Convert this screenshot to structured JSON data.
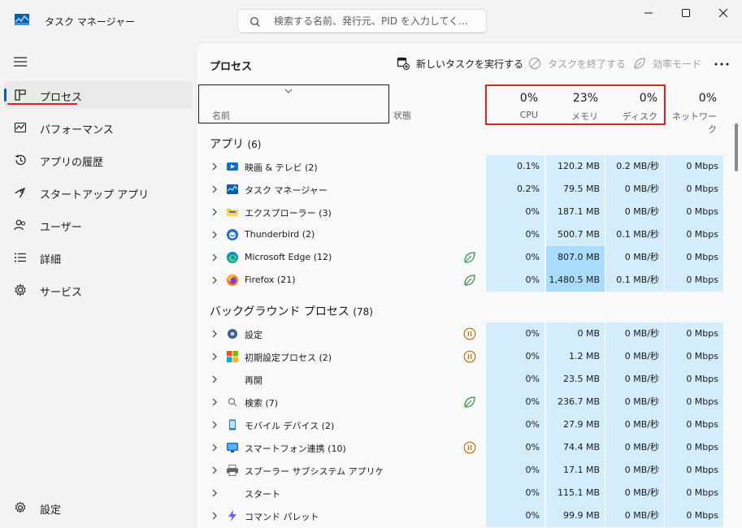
{
  "window": {
    "title": "タスク マネージャー",
    "search_placeholder": "検索する名前、発行元、PID を入力してく..."
  },
  "sidebar": {
    "items": [
      {
        "name": "processes",
        "label": "プロセス",
        "icon": "processes-icon",
        "active": true
      },
      {
        "name": "performance",
        "label": "パフォーマンス",
        "icon": "performance-icon"
      },
      {
        "name": "app-history",
        "label": "アプリの履歴",
        "icon": "history-icon"
      },
      {
        "name": "startup-apps",
        "label": "スタートアップ アプリ",
        "icon": "startup-icon"
      },
      {
        "name": "users",
        "label": "ユーザー",
        "icon": "users-icon"
      },
      {
        "name": "details",
        "label": "詳細",
        "icon": "details-icon"
      },
      {
        "name": "services",
        "label": "サービス",
        "icon": "services-icon"
      }
    ],
    "settings_label": "設定"
  },
  "toolbar": {
    "page_title": "プロセス",
    "new_task_label": "新しいタスクを実行する",
    "end_task_label": "タスクを終了する",
    "efficiency_label": "効率モード"
  },
  "columns": {
    "name": "名前",
    "status": "状態",
    "cpu": {
      "pct": "0%",
      "label": "CPU"
    },
    "memory": {
      "pct": "23%",
      "label": "メモリ"
    },
    "disk": {
      "pct": "0%",
      "label": "ディスク"
    },
    "network": {
      "pct": "0%",
      "label": "ネットワーク"
    }
  },
  "sections": {
    "apps": {
      "title": "アプリ",
      "count": "(6)"
    },
    "background": {
      "title": "バックグラウンド プロセス",
      "count": "(78)"
    }
  },
  "apps": [
    {
      "name": "映画 & テレビ",
      "count": "(2)",
      "icon": "movies-tv-icon",
      "status": "",
      "cpu": "0.1%",
      "mem": "120.2 MB",
      "disk": "0.2 MB/秒",
      "net": "0 Mbps"
    },
    {
      "name": "タスク マネージャー",
      "count": "",
      "icon": "task-manager-icon",
      "status": "",
      "cpu": "0.2%",
      "mem": "79.5 MB",
      "disk": "0 MB/秒",
      "net": "0 Mbps"
    },
    {
      "name": "エクスプローラー",
      "count": "(3)",
      "icon": "folder-icon",
      "status": "",
      "cpu": "0%",
      "mem": "187.1 MB",
      "disk": "0 MB/秒",
      "net": "0 Mbps"
    },
    {
      "name": "Thunderbird",
      "count": "(2)",
      "icon": "thunderbird-icon",
      "status": "",
      "cpu": "0%",
      "mem": "500.7 MB",
      "disk": "0.1 MB/秒",
      "net": "0 Mbps"
    },
    {
      "name": "Microsoft Edge",
      "count": "(12)",
      "icon": "edge-icon",
      "status": "efficiency-leaf-icon",
      "cpu": "0%",
      "mem": "807.0 MB",
      "disk": "0 MB/秒",
      "net": "0 Mbps",
      "hot": true
    },
    {
      "name": "Firefox",
      "count": "(21)",
      "icon": "firefox-icon",
      "status": "efficiency-leaf-icon",
      "cpu": "0%",
      "mem": "1,480.5 MB",
      "disk": "0.1 MB/秒",
      "net": "0 Mbps",
      "hot": true
    }
  ],
  "background": [
    {
      "name": "設定",
      "count": "",
      "icon": "settings-gear-icon",
      "status": "paused-icon",
      "cpu": "0%",
      "mem": "0 MB",
      "disk": "0 MB/秒",
      "net": "0 Mbps"
    },
    {
      "name": "初期設定プロセス",
      "count": "(2)",
      "icon": "windows-logo-icon",
      "status": "paused-icon",
      "cpu": "0%",
      "mem": "1.2 MB",
      "disk": "0 MB/秒",
      "net": "0 Mbps"
    },
    {
      "name": "再開",
      "count": "",
      "icon": "",
      "status": "",
      "cpu": "0%",
      "mem": "23.5 MB",
      "disk": "0 MB/秒",
      "net": "0 Mbps"
    },
    {
      "name": "検索",
      "count": "(7)",
      "icon": "search-process-icon",
      "status": "efficiency-leaf-icon",
      "cpu": "0%",
      "mem": "236.7 MB",
      "disk": "0 MB/秒",
      "net": "0 Mbps"
    },
    {
      "name": "モバイル デバイス",
      "count": "(2)",
      "icon": "mobile-devices-icon",
      "status": "",
      "cpu": "0%",
      "mem": "27.9 MB",
      "disk": "0 MB/秒",
      "net": "0 Mbps"
    },
    {
      "name": "スマートフォン連携",
      "count": "(10)",
      "icon": "phone-link-icon",
      "status": "paused-icon",
      "cpu": "0%",
      "mem": "74.4 MB",
      "disk": "0 MB/秒",
      "net": "0 Mbps"
    },
    {
      "name": "スプーラー サブシステム アプリケーシ...",
      "count": "",
      "icon": "printer-icon",
      "status": "",
      "cpu": "0%",
      "mem": "17.1 MB",
      "disk": "0 MB/秒",
      "net": "0 Mbps"
    },
    {
      "name": "スタート",
      "count": "",
      "icon": "",
      "status": "",
      "cpu": "0%",
      "mem": "115.1 MB",
      "disk": "0 MB/秒",
      "net": "0 Mbps"
    },
    {
      "name": "コマンド パレット",
      "count": "",
      "icon": "command-palette-icon",
      "status": "",
      "cpu": "0%",
      "mem": "99.9 MB",
      "disk": "0 MB/秒",
      "net": "0 Mbps"
    }
  ],
  "colors": {
    "accent": "#005fb8",
    "annotation_red": "#e41e26",
    "cell_bg": "#d3edfc",
    "cell_hot": "#a9dbfb"
  }
}
